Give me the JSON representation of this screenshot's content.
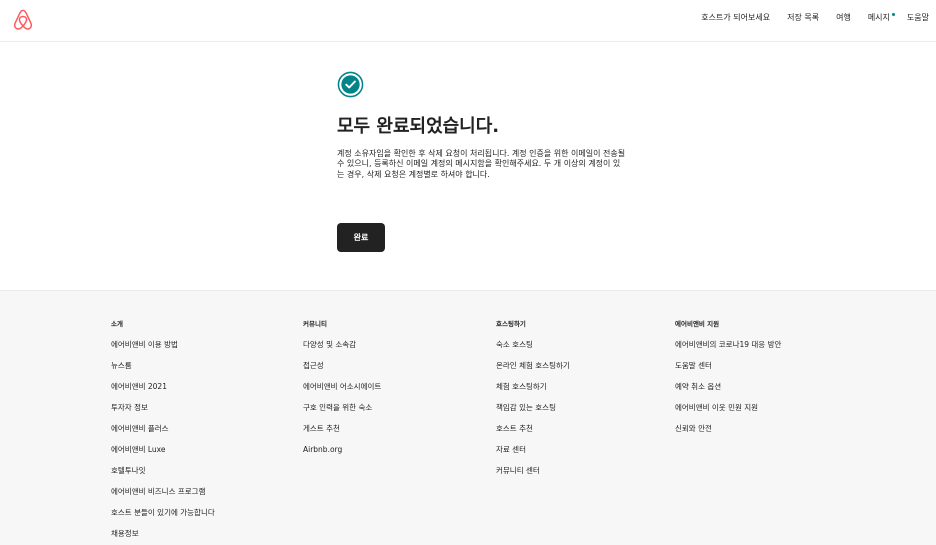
{
  "header": {
    "logo_icon": "airbnb-belo-logo",
    "brand_color": "#FF5A5F",
    "nav": [
      {
        "label": "호스트가 되어보세요"
      },
      {
        "label": "저장 목록"
      },
      {
        "label": "여행"
      },
      {
        "label": "메시지",
        "has_dot": true
      },
      {
        "label": "도움말"
      }
    ]
  },
  "main": {
    "icon": "check-circle-icon",
    "icon_color": "#008489",
    "title": "모두 완료되었습니다.",
    "description": "계정 소유자임을 확인한 후 삭제 요청이 처리됩니다. 계정 인증을 위한 이메일이 전송될 수 있으니, 등록하신 이메일 계정의 메시지함을 확인해주세요. 두 개 이상의 계정이 있는 경우, 삭제 요청은 계정별로 하셔야 합니다.",
    "button_label": "완료"
  },
  "footer": {
    "columns": [
      {
        "heading": "소개",
        "links": [
          "에어비앤비 이용 방법",
          "뉴스룸",
          "에어비앤비 2021",
          "투자자 정보",
          "에어비앤비 플러스",
          "에어비앤비 Luxe",
          "호텔투나잇",
          "에어비앤비 비즈니스 프로그램",
          "호스트 분들이 있기에 가능합니다",
          "채용정보"
        ]
      },
      {
        "heading": "커뮤니티",
        "links": [
          "다양성 및 소속감",
          "접근성",
          "에어비앤비 어소시에이트",
          "구호 인력을 위한 숙소",
          "게스트 추천",
          "Airbnb.org"
        ]
      },
      {
        "heading": "호스팅하기",
        "links": [
          "숙소 호스팅",
          "온라인 체험 호스팅하기",
          "체험 호스팅하기",
          "책임감 있는 호스팅",
          "호스트 추천",
          "자료 센터",
          "커뮤니티 센터"
        ]
      },
      {
        "heading": "에어비앤비 지원",
        "links": [
          "에어비앤비의 코로나19 대응 방안",
          "도움말 센터",
          "예약 취소 옵션",
          "에어비앤비 이웃 민원 지원",
          "신뢰와 안전"
        ]
      }
    ]
  }
}
